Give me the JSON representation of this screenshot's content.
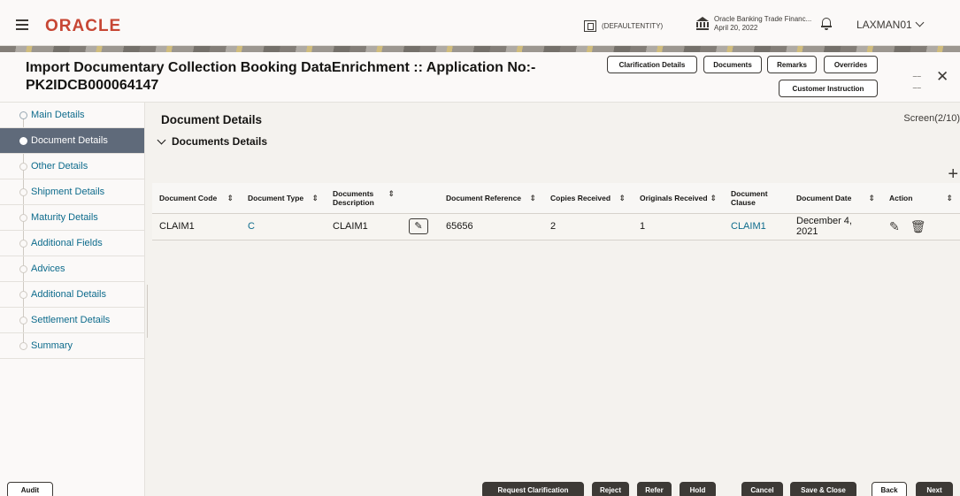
{
  "topbar": {
    "brand": "ORACLE",
    "entity": "(DEFAULTENTITY)",
    "branch_name": "Oracle Banking Trade Financ...",
    "branch_date": "April 20, 2022",
    "user": "LAXMAN01"
  },
  "header": {
    "title_line1": "Import Documentary Collection Booking DataEnrichment :: Application No:-",
    "title_line2": "PK2IDCB000064147",
    "buttons": {
      "clarification": "Clarification Details",
      "documents": "Documents",
      "remarks": "Remarks",
      "overrides": "Overrides",
      "customer_instruction": "Customer Instruction"
    }
  },
  "sidebar": {
    "items": [
      {
        "label": "Main Details"
      },
      {
        "label": "Document Details"
      },
      {
        "label": "Other Details"
      },
      {
        "label": "Shipment Details"
      },
      {
        "label": "Maturity Details"
      },
      {
        "label": "Additional Fields"
      },
      {
        "label": "Advices"
      },
      {
        "label": "Additional Details"
      },
      {
        "label": "Settlement Details"
      },
      {
        "label": "Summary"
      }
    ]
  },
  "main": {
    "section_title": "Document Details",
    "screen_indicator": "Screen(2/10)",
    "subsection_title": "Documents Details",
    "columns": {
      "code": "Document Code",
      "type": "Document Type",
      "description": "Documents Description",
      "reference": "Document Reference",
      "copies": "Copies Received",
      "originals": "Originals Received",
      "clause": "Document Clause",
      "date": "Document Date",
      "action": "Action"
    },
    "rows": [
      {
        "code": "CLAIM1",
        "type": "C",
        "description": "CLAIM1",
        "reference": "65656",
        "copies": "2",
        "originals": "1",
        "clause": "CLAIM1",
        "date": "December 4, 2021"
      }
    ]
  },
  "footer": {
    "audit": "Audit",
    "request_clarification": "Request Clarification",
    "reject": "Reject",
    "refer": "Refer",
    "hold": "Hold",
    "cancel": "Cancel",
    "save_close": "Save & Close",
    "back": "Back",
    "next": "Next"
  },
  "colors": {
    "brand": "#c74634",
    "link": "#0d6b8c",
    "active_nav": "#5f6a7a",
    "dark_button": "#3d3a36"
  }
}
